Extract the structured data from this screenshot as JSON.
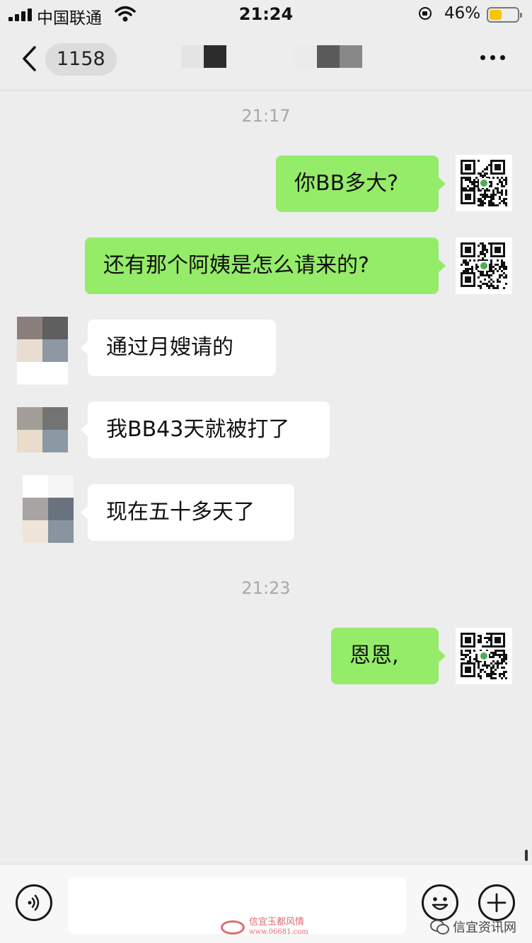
{
  "status_bar": {
    "carrier": "中国联通",
    "time": "21:24",
    "battery_percent": "46%",
    "battery_level": 0.46,
    "icons": [
      "signal-icon",
      "wifi-icon",
      "orientation-lock-icon",
      "battery-icon"
    ]
  },
  "nav": {
    "unread_count": "1158",
    "icons": [
      "back-icon",
      "more-icon"
    ]
  },
  "colors": {
    "background": "#ededed",
    "outgoing_bubble": "#95ec69",
    "incoming_bubble": "#ffffff",
    "battery_fill": "#f7c600"
  },
  "chat": {
    "timestamps": [
      "21:17",
      "21:23"
    ],
    "messages": [
      {
        "side": "outgoing",
        "text": "你BB多大?"
      },
      {
        "side": "outgoing",
        "text": "还有那个阿姨是怎么请来的?"
      },
      {
        "side": "incoming",
        "text": "通过月嫂请的"
      },
      {
        "side": "incoming",
        "text": "我BB43天就被打了"
      },
      {
        "side": "incoming",
        "text": "现在五十多天了"
      },
      {
        "side": "outgoing",
        "text": "恩恩,"
      }
    ]
  },
  "input_bar": {
    "input_value": "",
    "icons": [
      "voice-icon",
      "emoji-icon",
      "plus-icon"
    ]
  },
  "watermarks": {
    "site_name": "信宜玉都风情",
    "site_url": "www.06681.com",
    "wechat_account": "信宜资讯网"
  }
}
